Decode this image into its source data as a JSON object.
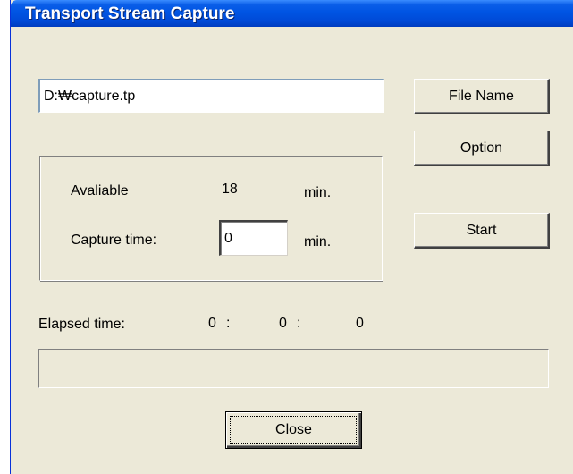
{
  "window": {
    "title": "Transport Stream Capture"
  },
  "file": {
    "path_value": "D:₩capture.tp"
  },
  "buttons": {
    "file_name": "File Name",
    "option": "Option",
    "start": "Start",
    "close": "Close"
  },
  "capture": {
    "available_label": "Avaliable",
    "available_value": "18",
    "available_unit": "min.",
    "time_label": "Capture time:",
    "time_value": "0",
    "time_unit": "min."
  },
  "elapsed": {
    "label": "Elapsed time:",
    "hours": "0",
    "sep1": ":",
    "minutes": "0",
    "sep2": ":",
    "seconds": "0"
  },
  "progress": {
    "fraction": 0
  }
}
